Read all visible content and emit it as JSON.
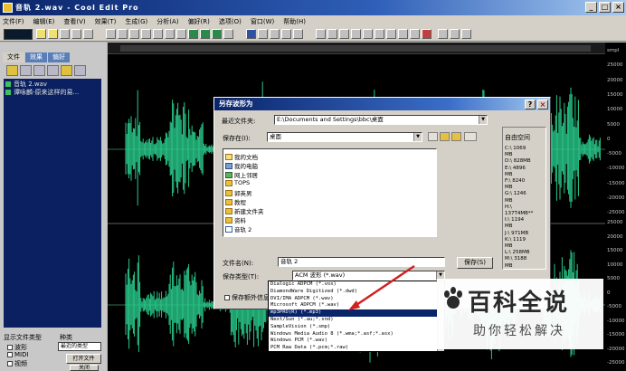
{
  "app": {
    "title": "音轨 2.wav - Cool Edit Pro",
    "window_buttons": [
      "_",
      "□",
      "×"
    ]
  },
  "menu": [
    "文件(F)",
    "编辑(E)",
    "查看(V)",
    "效果(T)",
    "生成(G)",
    "分析(A)",
    "偏好(R)",
    "选项(O)",
    "窗口(W)",
    "帮助(H)"
  ],
  "left": {
    "tabs": [
      "文件",
      "效果",
      "偏好"
    ],
    "files": [
      "音轨 2.wav",
      "谭咏麟-原来这样的易..."
    ],
    "show_label": "显示文件类型",
    "sort_label": "种类",
    "sort_value": "最近的类型",
    "types": [
      "波形",
      "MIDI",
      "视频"
    ],
    "btn1": "打开文件",
    "btn2": "关闭"
  },
  "scale": {
    "unit": "smpl",
    "top": [
      "smpl",
      "25000",
      "20000",
      "15000",
      "10000",
      "5000",
      "0",
      "-5000",
      "-10000",
      "-15000",
      "-20000",
      "-25000"
    ],
    "bottom": [
      "25000",
      "20000",
      "15000",
      "10000",
      "5000",
      "0",
      "-5000",
      "-10000",
      "-15000",
      "-20000",
      "-25000"
    ]
  },
  "dialog": {
    "title": "另存波形为",
    "recent_label": "最近文件夹:",
    "recent_value": "E:\\Documents and Settings\\bbc\\桌面",
    "save_in_label": "保存在(I):",
    "save_in_value": "桌面",
    "items": [
      "我的文档",
      "我的电脑",
      "网上邻居",
      "TOPS",
      "郭英男",
      "教程",
      "新建文件夹",
      "资料",
      "音轨 2"
    ],
    "free_space_label": "自由空间",
    "drives": [
      "C:\\ 1069",
      "MB",
      "D:\\ 828MB",
      "E:\\ 4896",
      "MB",
      "F:\\ 8240",
      "MB",
      "G:\\ 1246",
      "MB",
      "H:\\",
      "137T4MB**",
      "I:\\ 1194",
      "MB",
      "J:\\ 971MB",
      "K:\\ 1119",
      "MB",
      "L:\\ 258MB",
      "M:\\ 3188",
      "MB"
    ],
    "filename_label": "文件名(N):",
    "filename_value": "音轨 2",
    "save_type_label": "保存类型(T):",
    "save_type_value": "ACM 波形 (*.wav)",
    "save_button": "保存(S)",
    "extra_label": "保存额外信息",
    "type_options": [
      "Dialogic ADPCM (*.vox)",
      "DiamondWare Digitized (*.dwd)",
      "DVI/IMA ADPCM (*.wav)",
      "Microsoft ADPCM (*.wav)",
      "mp3PRO(R) (*.mp3)",
      "Next/Sun (*.au;*.snd)",
      "SampleVision (*.smp)",
      "Windows Media Audio 8 (*.wma;*.asf;*.asx)",
      "Windows PCM (*.wav)",
      "PCM Raw Data (*.pcm;*.raw)"
    ],
    "selected_option": "mp3PRO(R) (*.mp3)"
  },
  "watermark": {
    "brand": "百科全说",
    "slogan": "助你轻松解决"
  },
  "colors": {
    "wave": "#29c98a",
    "title": "#0a246a",
    "selection": "#0a246a",
    "arrow": "#d02020"
  }
}
